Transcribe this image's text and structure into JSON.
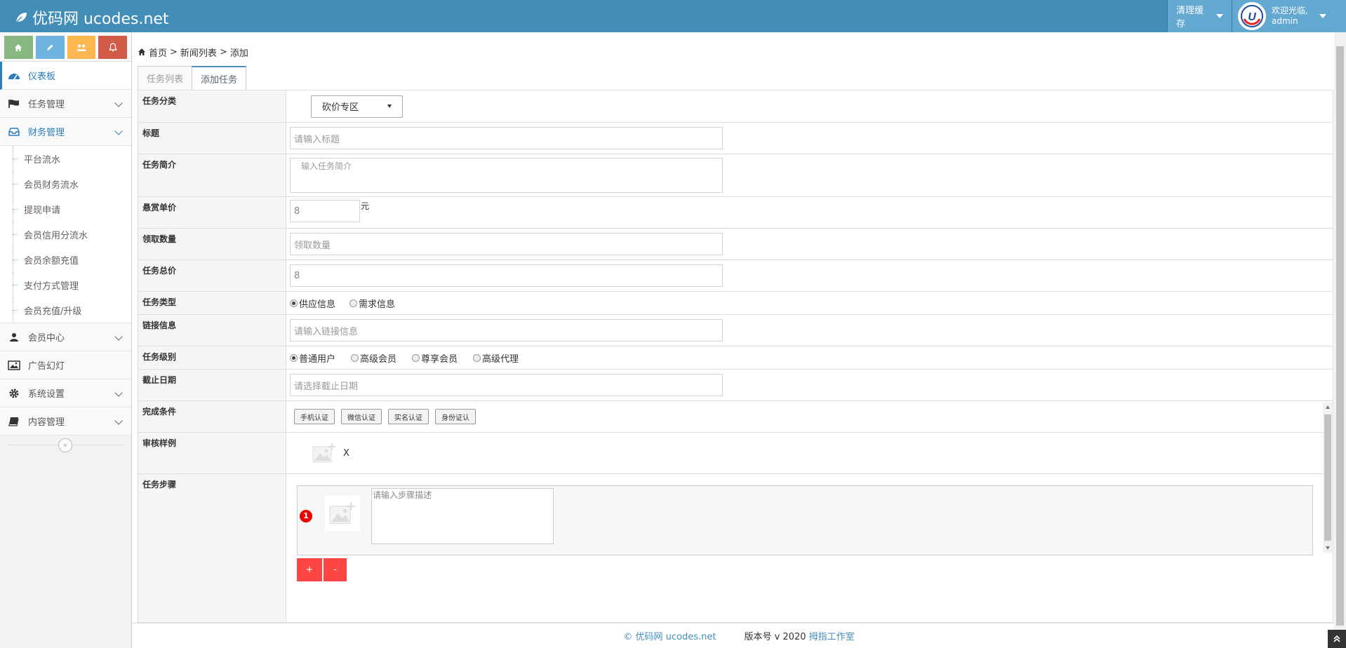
{
  "navbar": {
    "brand": "优码网 ucodes.net",
    "cache_label": "清理缓存",
    "welcome": "欢迎光临,",
    "username": "admin"
  },
  "sidebar": {
    "items": [
      {
        "label": "仪表板"
      },
      {
        "label": "任务管理"
      },
      {
        "label": "财务管理"
      },
      {
        "label": "会员中心"
      },
      {
        "label": "广告幻灯"
      },
      {
        "label": "系统设置"
      },
      {
        "label": "内容管理"
      }
    ],
    "finance_sub": [
      "平台流水",
      "会员财务流水",
      "提现申请",
      "会员信用分流水",
      "会员余额充值",
      "支付方式管理",
      "会员充值/升级"
    ],
    "collapse": "«"
  },
  "breadcrumb": {
    "home": "首页",
    "sep1": ">",
    "list": "新闻列表",
    "sep2": ">",
    "current": "添加"
  },
  "tabs": [
    "任务列表",
    "添加任务"
  ],
  "form": {
    "category": {
      "label": "任务分类",
      "value": "砍价专区"
    },
    "title": {
      "label": "标题",
      "placeholder": "请输入标题"
    },
    "intro": {
      "label": "任务简介",
      "placeholder": "输入任务简介"
    },
    "unit_price": {
      "label": "悬赏单价",
      "value": "8",
      "unit": "元"
    },
    "quantity": {
      "label": "领取数量",
      "placeholder": "领取数量"
    },
    "total": {
      "label": "任务总价",
      "value": "8"
    },
    "type": {
      "label": "任务类型",
      "options": [
        "供应信息",
        "需求信息"
      ]
    },
    "link": {
      "label": "链接信息",
      "placeholder": "请输入链接信息"
    },
    "level": {
      "label": "任务级别",
      "options": [
        "普通用户",
        "高级会员",
        "尊享会员",
        "高级代理"
      ]
    },
    "deadline": {
      "label": "截止日期",
      "placeholder": "请选择截止日期"
    },
    "conditions": {
      "label": "完成条件",
      "buttons": [
        "手机认证",
        "微信认证",
        "实名认证",
        "身份证认"
      ]
    },
    "sample": {
      "label": "审核样例",
      "remove": "X"
    },
    "steps": {
      "label": "任务步骤",
      "num": "1",
      "placeholder": "请输入步骤描述",
      "add": "+",
      "remove": "-"
    }
  },
  "footer": {
    "copyright": "© 优码网 ucodes.net",
    "version": "版本号 v 2020 ",
    "studio": "拇指工作室"
  },
  "colors": {
    "navbar": "#438eb9",
    "accent": "#2b7dbc",
    "danger": "#ff4444"
  }
}
